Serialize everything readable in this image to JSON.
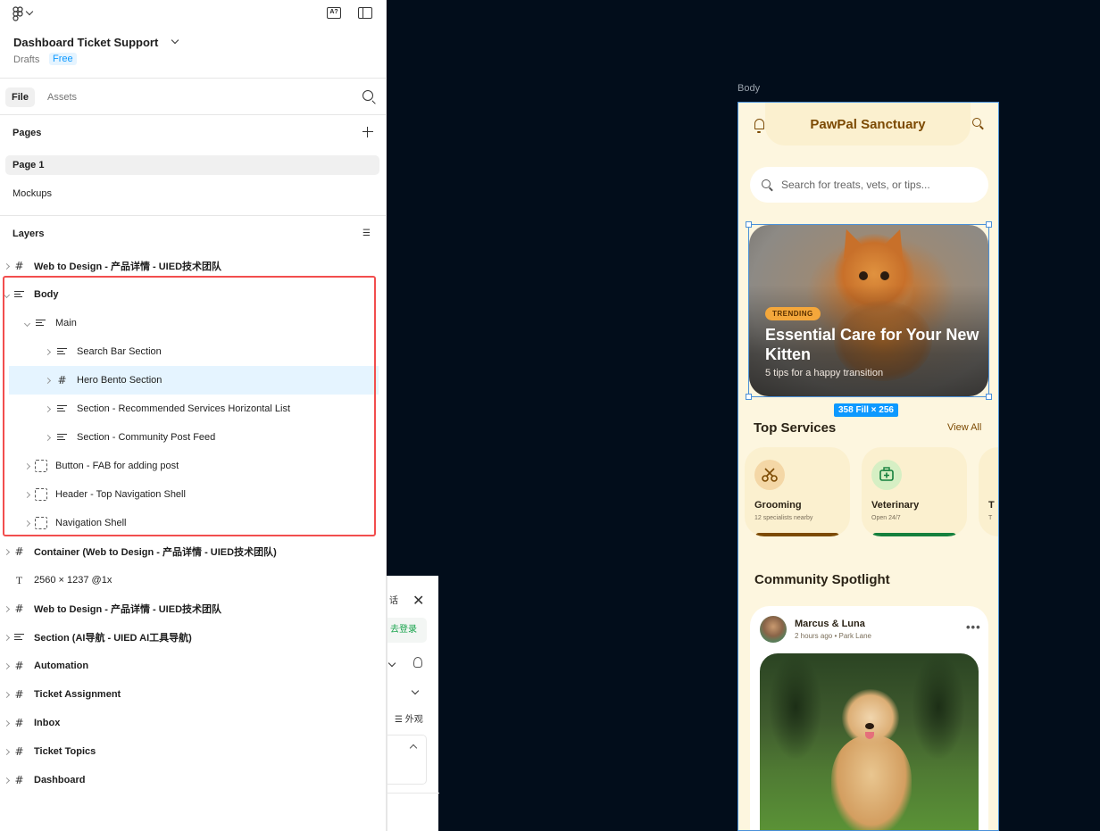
{
  "file": {
    "title": "Dashboard Ticket Support",
    "location": "Drafts",
    "plan": "Free"
  },
  "tabs": [
    {
      "label": "File"
    },
    {
      "label": "Assets"
    }
  ],
  "pages": {
    "heading": "Pages",
    "items": [
      {
        "label": "Page 1"
      },
      {
        "label": "Mockups"
      }
    ]
  },
  "layers": {
    "heading": "Layers",
    "items": [
      {
        "label": "Web to Design - 产品详情 - UIED技术团队",
        "icon": "frame-icon"
      },
      {
        "label": "Body",
        "icon": "auto-layout-icon"
      },
      {
        "label": "Main",
        "icon": "auto-layout-icon"
      },
      {
        "label": "Search Bar Section",
        "icon": "auto-layout-icon"
      },
      {
        "label": "Hero Bento Section",
        "icon": "frame-icon"
      },
      {
        "label": "Section - Recommended Services Horizontal List",
        "icon": "auto-layout-icon"
      },
      {
        "label": "Section - Community Post Feed",
        "icon": "auto-layout-icon"
      },
      {
        "label": "Button - FAB for adding post",
        "icon": "component-icon"
      },
      {
        "label": "Header - Top Navigation Shell",
        "icon": "component-icon"
      },
      {
        "label": "Navigation Shell",
        "icon": "component-icon"
      },
      {
        "label": "Container (Web to Design - 产品详情 - UIED技术团队)",
        "icon": "frame-icon"
      },
      {
        "label": "2560 × 1237 @1x",
        "icon": "text-icon"
      },
      {
        "label": "Web to Design - 产品详情 - UIED技术团队",
        "icon": "frame-icon"
      },
      {
        "label": "Section (AI导航 - UIED AI工具导航)",
        "icon": "auto-layout-icon"
      },
      {
        "label": "Automation",
        "icon": "frame-icon"
      },
      {
        "label": "Ticket Assignment",
        "icon": "frame-icon"
      },
      {
        "label": "Inbox",
        "icon": "frame-icon"
      },
      {
        "label": "Ticket Topics",
        "icon": "frame-icon"
      },
      {
        "label": "Dashboard",
        "icon": "frame-icon"
      }
    ]
  },
  "overlay": {
    "text1": "话",
    "login": "去登录",
    "appearance": "外观"
  },
  "canvas": {
    "frame_label": "Body",
    "selection_size": "358 Fill × 256",
    "app": {
      "title": "PawPal Sanctuary",
      "search_placeholder": "Search for treats, vets, or tips...",
      "hero": {
        "badge": "TRENDING",
        "title": "Essential Care for Your New Kitten",
        "subtitle": "5 tips for a happy transition"
      },
      "services_heading": "Top Services",
      "view_all": "View All",
      "services": [
        {
          "name": "Grooming",
          "info": "12 specialists nearby",
          "icon": "scissors-icon",
          "color": "#f4d7a6",
          "accent": "#7c4a03"
        },
        {
          "name": "Veterinary",
          "info": "Open 24/7",
          "icon": "medical-kit-icon",
          "color": "#d6efc4",
          "accent": "#15803d"
        },
        {
          "name": "T",
          "info": "T",
          "icon": "",
          "color": "#f4d7a6",
          "accent": "#7c4a03"
        }
      ],
      "community_heading": "Community Spotlight",
      "post": {
        "user": "Marcus & Luna",
        "meta": "2 hours ago • Park Lane"
      }
    }
  }
}
